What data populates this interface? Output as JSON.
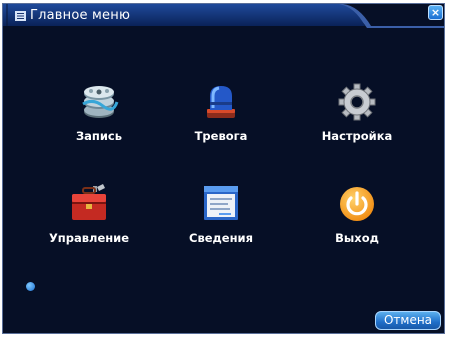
{
  "window": {
    "title": "Главное меню",
    "close_symbol": "×"
  },
  "menu_items": [
    {
      "label": "Запись",
      "icon": "film-reel-icon"
    },
    {
      "label": "Тревога",
      "icon": "alarm-siren-icon"
    },
    {
      "label": "Настройка",
      "icon": "gear-icon"
    },
    {
      "label": "Управление",
      "icon": "toolbox-icon"
    },
    {
      "label": "Сведения",
      "icon": "info-window-icon"
    },
    {
      "label": "Выход",
      "icon": "power-icon"
    }
  ],
  "footer": {
    "cancel_label": "Отмена"
  },
  "colors": {
    "background": "#060f26",
    "title_tab": "#0e2d6e",
    "accent": "#1f6ec8",
    "text": "#ffffff"
  }
}
